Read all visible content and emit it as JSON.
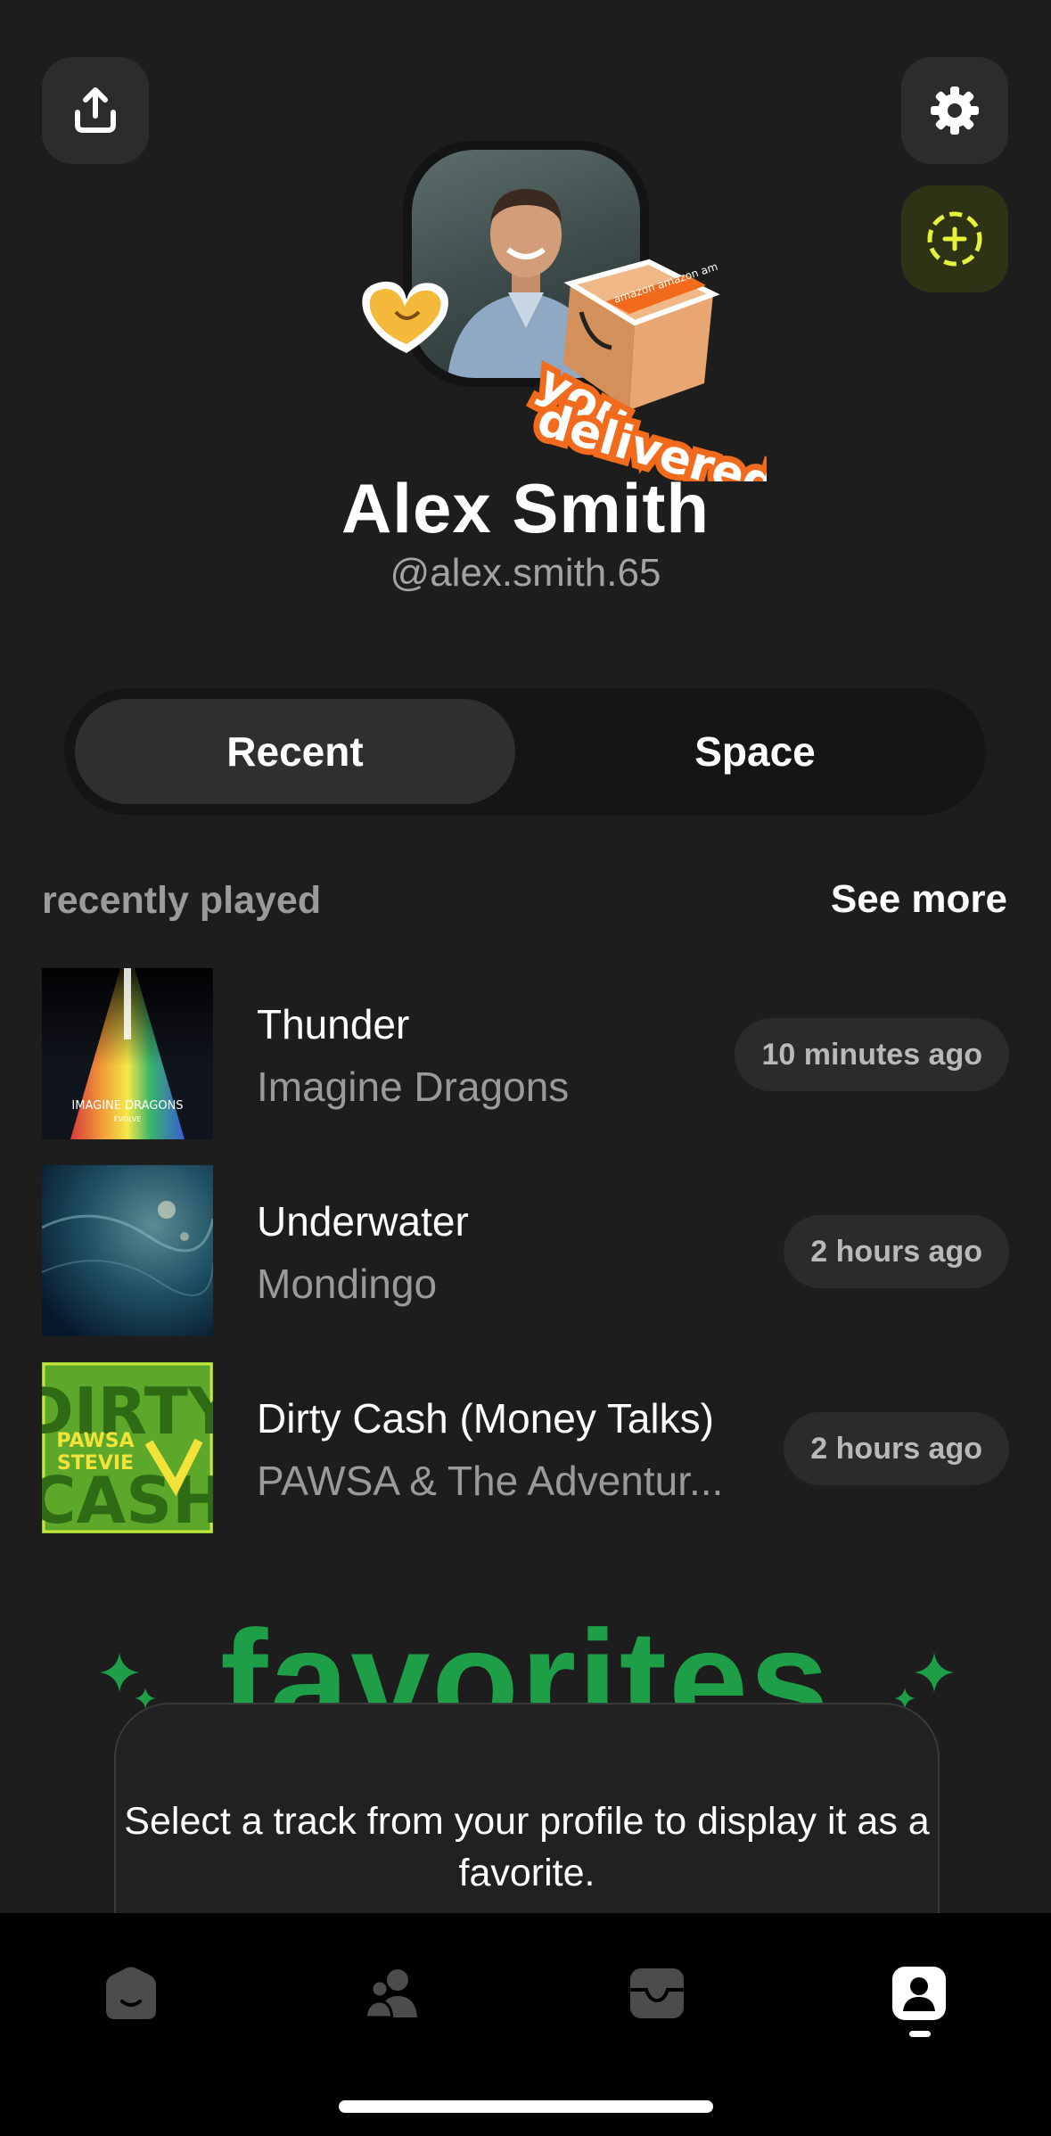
{
  "header": {
    "share_icon": "share-icon",
    "settings_icon": "gear-icon",
    "add_icon": "add-circle-icon"
  },
  "profile": {
    "name": "Alex Smith",
    "handle": "@alex.smith.65",
    "sticker_text_1": "you",
    "sticker_text_2": "delivered",
    "box_label": "amazon amazon am"
  },
  "tabs": [
    {
      "label": "Recent",
      "selected": true
    },
    {
      "label": "Space",
      "selected": false
    }
  ],
  "recent": {
    "title": "recently played",
    "see_more": "See more",
    "tracks": [
      {
        "title": "Thunder",
        "artist": "Imagine Dragons",
        "time": "10 minutes ago",
        "cover_text": "IMAGINE DRAGONS",
        "cover_sub": "EVOLVE"
      },
      {
        "title": "Underwater",
        "artist": "Mondingo",
        "time": "2 hours ago"
      },
      {
        "title": "Dirty Cash (Money Talks)",
        "artist": "PAWSA & The Adventur...",
        "time": "2 hours ago",
        "cover_text_1": "DIRTY",
        "cover_text_2": "CASH",
        "cover_text_3": "PAWSA",
        "cover_text_4": "STEVIE"
      }
    ]
  },
  "favorites": {
    "heading": "favorites",
    "message": "Select a track from your profile to display it as a favorite."
  },
  "nav": {
    "items": [
      "home-icon",
      "friends-icon",
      "inbox-icon",
      "profile-icon"
    ],
    "active": "profile-icon"
  },
  "colors": {
    "accent_yellow": "#e6f23a",
    "favorites_green": "#1f9e48",
    "sticker_orange": "#f26a1b"
  }
}
